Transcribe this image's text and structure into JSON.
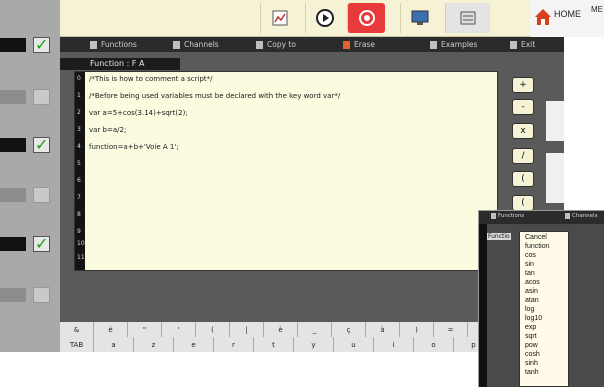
{
  "toolbar": {
    "home_label": "HOME",
    "edge_label": "ME",
    "icons": [
      "chart-icon",
      "play-icon",
      "record-icon",
      "monitor-icon",
      "settings-icon",
      "home-icon"
    ]
  },
  "menu": {
    "items": [
      {
        "label": "Functions",
        "icon": "book-icon"
      },
      {
        "label": "Channels",
        "icon": "channels-icon"
      },
      {
        "label": "Copy to",
        "icon": "copy-icon"
      },
      {
        "label": "Erase",
        "icon": "erase-icon"
      },
      {
        "label": "Examples",
        "icon": "examples-icon"
      },
      {
        "label": "Exit",
        "icon": "exit-icon"
      }
    ]
  },
  "editor": {
    "title": "Function : F A",
    "line_numbers": [
      "0",
      "1",
      "2",
      "3",
      "4",
      "5",
      "6",
      "7",
      "8",
      "9",
      "10",
      "11"
    ],
    "lines": [
      "/*This is how to comment a script*/",
      "/*Before being used variables must be declared with the key word var*/",
      "var a=5+cos(3.14)+sqrt(2);",
      "var b=a/2;",
      "function=a+b+'Voie A 1';"
    ]
  },
  "operators": [
    "+",
    "-",
    "x",
    "/",
    "(",
    "("
  ],
  "keyboard": {
    "row1": [
      "&",
      "é",
      "\"",
      "'",
      "(",
      "|",
      "è",
      "_",
      "ç",
      "à",
      ")",
      "="
    ],
    "row2": [
      "TAB",
      "a",
      "z",
      "e",
      "r",
      "t",
      "y",
      "u",
      "i",
      "o",
      "p"
    ]
  },
  "popup": {
    "menu_functions": "Functions",
    "menu_channels": "Channels",
    "fn_label": "Functio",
    "items": [
      "Cancel",
      "function",
      "cos",
      "sin",
      "tan",
      "acos",
      "asin",
      "atan",
      "log",
      "log10",
      "exp",
      "sqrt",
      "pow",
      "cosh",
      "sinh",
      "tanh"
    ]
  },
  "colors": {
    "toolbar_bg": "#f6f2d6",
    "editor_bg": "#fbfbe0",
    "checkbox_green": "#18a018",
    "record_red": "#e83a3a"
  }
}
